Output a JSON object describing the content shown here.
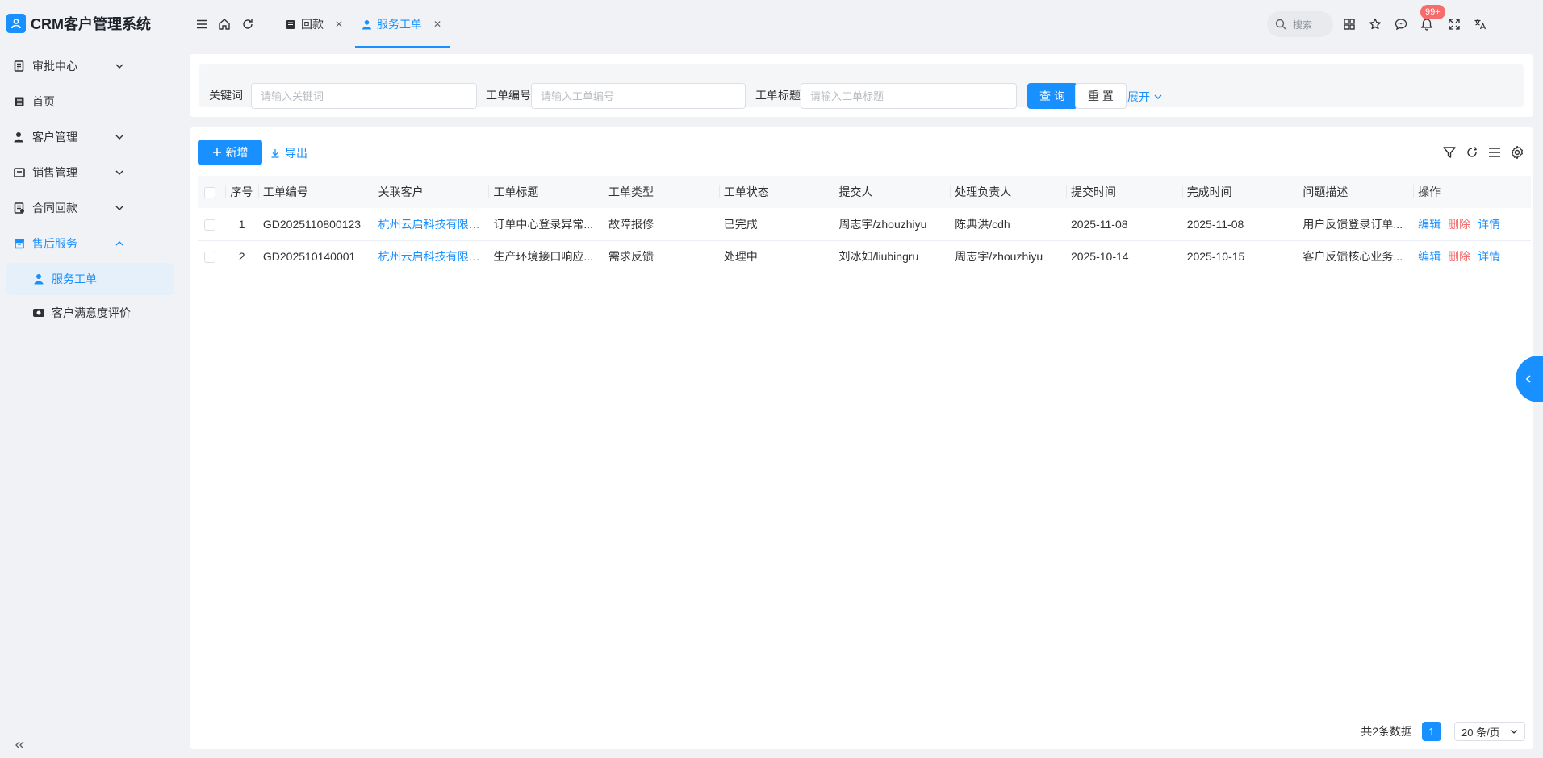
{
  "app": {
    "title": "CRM客户管理系统"
  },
  "sidebar": {
    "items": [
      {
        "label": "审批中心"
      },
      {
        "label": "首页"
      },
      {
        "label": "客户管理"
      },
      {
        "label": "销售管理"
      },
      {
        "label": "合同回款"
      },
      {
        "label": "售后服务"
      }
    ],
    "sub_items": [
      {
        "label": "服务工单"
      },
      {
        "label": "客户满意度评价"
      }
    ]
  },
  "header": {
    "tabs": [
      {
        "label": "回款"
      },
      {
        "label": "服务工单"
      }
    ],
    "search_label": "搜索",
    "notification_count": "99+"
  },
  "search": {
    "keyword_label": "关键词",
    "keyword_placeholder": "请输入关键词",
    "order_no_label": "工单编号",
    "order_no_placeholder": "请输入工单编号",
    "order_title_label": "工单标题",
    "order_title_placeholder": "请输入工单标题",
    "query_button": "查 询",
    "reset_button": "重 置",
    "expand_link": "展开"
  },
  "toolbar": {
    "add_button": "新增",
    "export_button": "导出"
  },
  "table": {
    "columns": [
      "序号",
      "工单编号",
      "关联客户",
      "工单标题",
      "工单类型",
      "工单状态",
      "提交人",
      "处理负责人",
      "提交时间",
      "完成时间",
      "问题描述",
      "操作"
    ],
    "rows": [
      [
        "1",
        "GD2025110800123",
        "杭州云启科技有限公司",
        "订单中心登录异常...",
        "故障报修",
        "已完成",
        "周志宇/zhouzhiyu",
        "陈典洪/cdh",
        "2025-11-08",
        "2025-11-08",
        "用户反馈登录订单..."
      ],
      [
        "2",
        "GD202510140001",
        "杭州云启科技有限公司",
        "生产环境接口响应...",
        "需求反馈",
        "处理中",
        "刘冰如/liubingru",
        "周志宇/zhouzhiyu",
        "2025-10-14",
        "2025-10-15",
        "客户反馈核心业务..."
      ]
    ],
    "ops": {
      "edit": "编辑",
      "delete": "删除",
      "detail": "详情"
    }
  },
  "pagination": {
    "total_text": "共2条数据",
    "current_page": "1",
    "page_size": "20 条/页"
  },
  "colors": {
    "primary": "#1890ff",
    "danger": "#f56c6c"
  }
}
